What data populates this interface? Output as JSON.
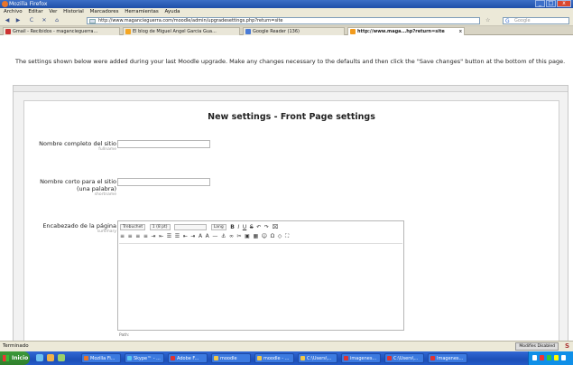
{
  "window": {
    "title": "Mozilla Firefox",
    "min": "_",
    "max": "□",
    "close": "x"
  },
  "menu": [
    "Archivo",
    "Editar",
    "Ver",
    "Historial",
    "Marcadores",
    "Herramientas",
    "Ayuda"
  ],
  "nav": {
    "back": "◀",
    "forward": "▶",
    "reload": "C",
    "stop": "✕",
    "home": "⌂",
    "url": "http://www.magancieguerra.com/moodle/admin/upgradesettings.php?return=site",
    "search_placeholder": "Google"
  },
  "tabs": [
    {
      "label": "Gmail - Recibidos - magancieguerra...",
      "active": false
    },
    {
      "label": "El blog de Miguel Angel Garcia Gua...",
      "active": false
    },
    {
      "label": "Google Reader (136)",
      "active": false
    },
    {
      "label": "http://www.maga...hp?return=site",
      "active": true
    }
  ],
  "page": {
    "notice": "The settings shown below were added during your last Moodle upgrade. Make any changes necessary to the defaults and then click the \"Save changes\" button at the bottom of this page.",
    "heading": "New settings - Front Page settings",
    "fields": [
      {
        "label": "Nombre completo del sitio",
        "sub": "fullname",
        "value": ""
      },
      {
        "label": "Nombre corto para el sitio",
        "label2": "(una palabra)",
        "sub": "shortname",
        "value": ""
      }
    ],
    "editor_label": "Encabezado de la página",
    "editor_sub": "summary",
    "editor_font": "Trebuchet",
    "editor_size": "1 (8 pt)",
    "editor_lang": "Lang",
    "editor_path": "Path:"
  },
  "status": {
    "text": "Terminado",
    "right": "Modifies Disabled"
  },
  "taskbar": {
    "start": "Inicio",
    "buttons": [
      "Mozilla Fi...",
      "Skype™ - ...",
      "Adobe F...",
      "moodle",
      "moodle - ...",
      "C:\\Users\\...",
      "imagenes...",
      "C:\\Users\\...",
      "Imagenes..."
    ]
  }
}
